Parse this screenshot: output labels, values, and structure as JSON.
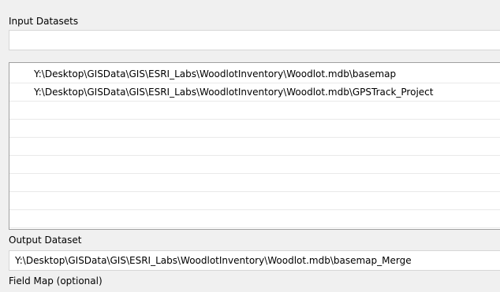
{
  "input_datasets": {
    "label": "Input Datasets",
    "entry_value": "",
    "items": [
      "Y:\\Desktop\\GISData\\GIS\\ESRI_Labs\\WoodlotInventory\\Woodlot.mdb\\basemap",
      "Y:\\Desktop\\GISData\\GIS\\ESRI_Labs\\WoodlotInventory\\Woodlot.mdb\\GPSTrack_Project",
      "",
      "",
      "",
      "",
      "",
      "",
      "",
      ""
    ]
  },
  "output_dataset": {
    "label": "Output Dataset",
    "value": "Y:\\Desktop\\GISData\\GIS\\ESRI_Labs\\WoodlotInventory\\Woodlot.mdb\\basemap_Merge"
  },
  "field_map": {
    "label": "Field Map (optional)"
  }
}
